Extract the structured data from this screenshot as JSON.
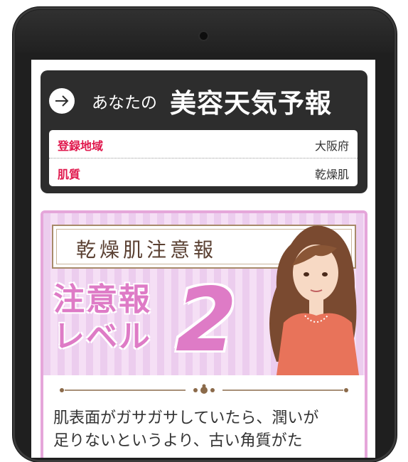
{
  "weather_card": {
    "title_prefix": "あなたの",
    "title_main": "美容天気予報",
    "rows": [
      {
        "label": "登録地域",
        "value": "大阪府"
      },
      {
        "label": "肌質",
        "value": "乾燥肌"
      }
    ]
  },
  "alert": {
    "banner": "乾燥肌注意報",
    "level_text_line1": "注意報",
    "level_text_line2": "レベル",
    "level_number": "2",
    "description_line1": "肌表面がガサガサしていたら、潤いが",
    "description_line2": "足りないというより、古い角質がた"
  },
  "colors": {
    "accent_red": "#e0184d",
    "alert_pink": "#de7bc6",
    "card_dark": "#2d2d2d"
  }
}
